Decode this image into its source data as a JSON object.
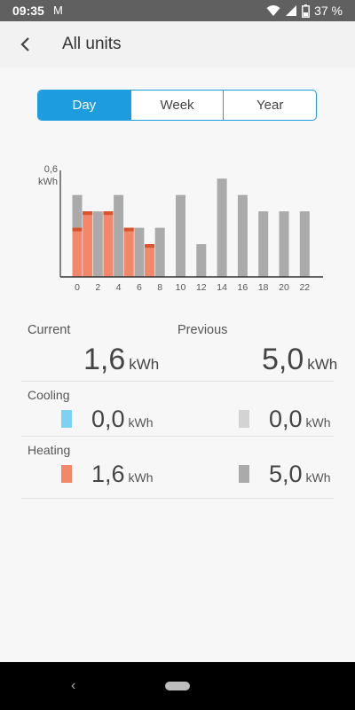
{
  "status": {
    "time": "09:35",
    "battery": "37 %",
    "mail_glyph": "M"
  },
  "header": {
    "title": "All units"
  },
  "tabs": [
    {
      "label": "Day",
      "active": true
    },
    {
      "label": "Week",
      "active": false
    },
    {
      "label": "Year",
      "active": false
    }
  ],
  "chart_data": {
    "type": "bar",
    "ylabel": "0,6\nkWh",
    "ylabel_lines": [
      "0,6",
      "kWh"
    ],
    "ylim": [
      0,
      0.65
    ],
    "x": [
      0,
      1,
      2,
      3,
      4,
      5,
      6,
      7,
      8,
      9,
      10,
      11,
      12,
      13,
      14,
      15,
      16,
      17,
      18,
      19,
      20,
      21,
      22,
      23
    ],
    "tick_labels": [
      "0",
      "2",
      "4",
      "6",
      "8",
      "10",
      "12",
      "14",
      "16",
      "18",
      "20",
      "22"
    ],
    "series": [
      {
        "values": [
          0.5,
          null,
          0.4,
          null,
          0.5,
          null,
          0.3,
          null,
          0.3,
          null,
          0.5,
          null,
          0.2,
          null,
          0.6,
          null,
          0.5,
          null,
          0.4,
          null,
          0.4,
          null,
          0.4,
          null
        ],
        "color": "#aaaaaa"
      },
      {
        "values": [
          0.3,
          0.4,
          null,
          0.4,
          null,
          0.3,
          null,
          0.2,
          null,
          null,
          null,
          null,
          null,
          null,
          null,
          null,
          null,
          null,
          null,
          null,
          null,
          null,
          null,
          null
        ],
        "color": "#f4876a",
        "cap_color": "#d9532f"
      }
    ]
  },
  "summary": {
    "current_label": "Current",
    "previous_label": "Previous",
    "current_value": "1,6",
    "previous_value": "5,0",
    "unit": "kWh",
    "cooling": {
      "label": "Cooling",
      "current": "0,0",
      "previous": "0,0",
      "current_color": "#7fd0f5",
      "previous_color": "#d3d3d3"
    },
    "heating": {
      "label": "Heating",
      "current": "1,6",
      "previous": "5,0",
      "current_color": "#f4876a",
      "previous_color": "#aaaaaa"
    }
  }
}
